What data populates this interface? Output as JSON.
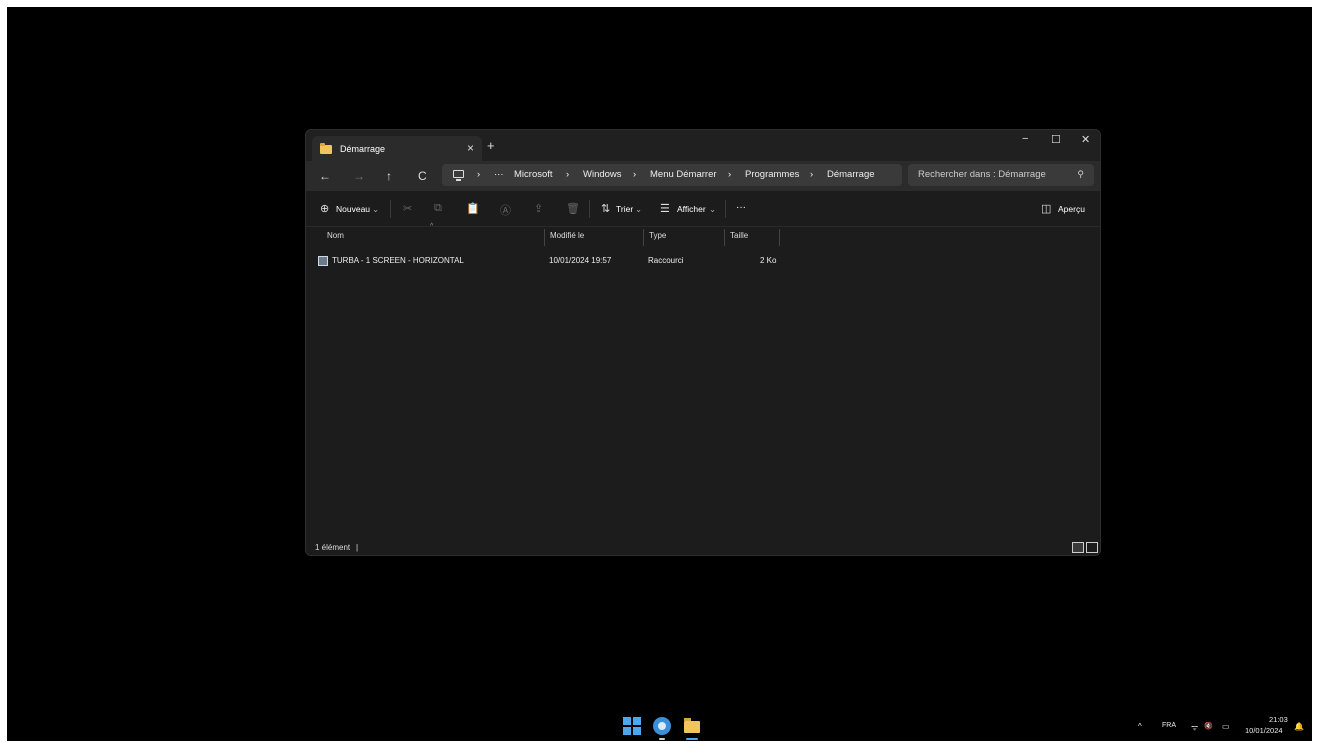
{
  "window": {
    "tab_title": "Démarrage",
    "tab_close": "×",
    "new_tab": "+",
    "controls": {
      "minimize": "−",
      "maximize": "☐",
      "close": "✕"
    }
  },
  "navigation": {
    "back": "←",
    "forward": "→",
    "up": "↑",
    "refresh": "C",
    "breadcrumb_sep": "›",
    "overflow": "···",
    "breadcrumb": [
      "Microsoft",
      "Windows",
      "Menu Démarrer",
      "Programmes",
      "Démarrage"
    ],
    "search_placeholder": "Rechercher dans : Démarrage",
    "search_icon": "⚲"
  },
  "toolbar": {
    "new_label": "Nouveau",
    "new_icon": "⊕",
    "dropdown_caret": "⌄",
    "cut_icon": "✂",
    "copy_icon": "⧉",
    "paste_icon": "📋",
    "rename_icon": "Ⓐ",
    "share_icon": "⇪",
    "delete_icon": "🗑",
    "sort_icon": "⇅",
    "sort_label": "Trier",
    "view_icon": "☰",
    "view_label": "Afficher",
    "more_label": "···",
    "preview_icon": "◫",
    "preview_label": "Aperçu"
  },
  "columns": {
    "name": "Nom",
    "modified": "Modifié le",
    "type": "Type",
    "size": "Taille",
    "sort_indicator": "^"
  },
  "files": [
    {
      "name": "TURBA - 1 SCREEN - HORIZONTAL",
      "modified": "10/01/2024 19:57",
      "type": "Raccourci",
      "size": "2 Ko"
    }
  ],
  "status": {
    "count": "1 élément",
    "separator": "|"
  },
  "taskbar": {
    "tray_chevron": "^",
    "language": "FRA",
    "wifi_icon": "ᯤ",
    "volume_icon": "🔇",
    "battery_icon": "▭",
    "time": "21:03",
    "date": "10/01/2024",
    "notification_icon": "🔔"
  }
}
